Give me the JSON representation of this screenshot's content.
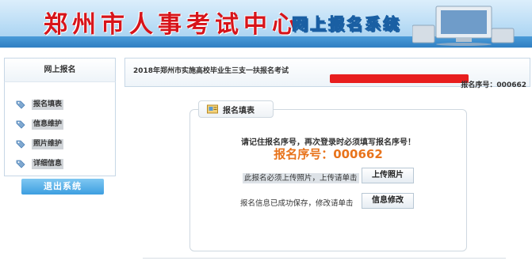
{
  "header": {
    "site_title": "郑州市人事考试中心",
    "system_title": "网上报名系统"
  },
  "sidebar": {
    "title": "网上报名",
    "items": [
      {
        "label": "报名填表"
      },
      {
        "label": "信息维护"
      },
      {
        "label": "照片维护"
      },
      {
        "label": "详细信息"
      }
    ],
    "logout_label": "退出系统"
  },
  "main": {
    "exam_title": "2018年郑州市实施高校毕业生三支一扶报名考试",
    "top_reg_no": "报名序号：000662",
    "form_tab_label": "报名填表",
    "notice": "请记住报名序号，再次登录时必须填写报名序号！",
    "big_reg_no": "报名序号：000662",
    "photo_hint": "此报名必须上传照片，上传请单击",
    "upload_button": "上传照片",
    "info_hint": "报名信息已成功保存，修改请单击",
    "modify_button": "信息修改"
  },
  "colors": {
    "accent_blue": "#3d9ee0",
    "reg_no_orange": "#e8731b",
    "redact_red": "#e81e1e"
  }
}
